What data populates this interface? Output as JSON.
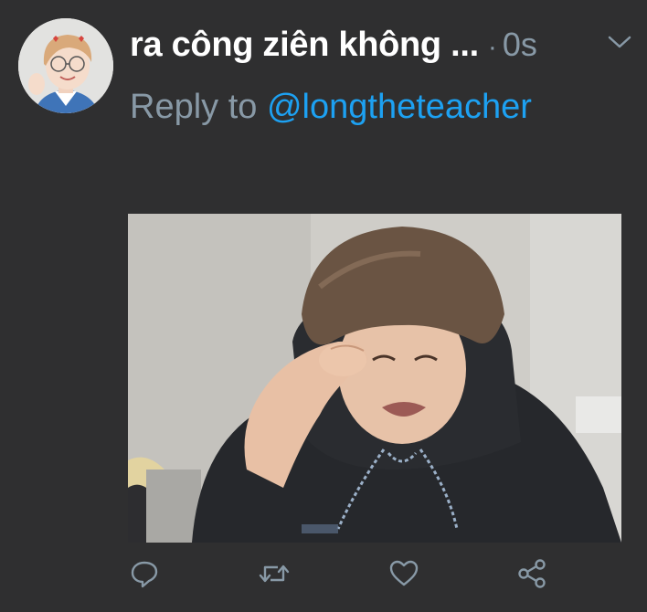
{
  "tweet": {
    "display_name": "ra công ziên không ...",
    "separator": "·",
    "timestamp": "0s",
    "reply_label": "Reply to",
    "reply_handle": "@longtheteacher"
  },
  "icons": {
    "caret": "chevron-down-icon",
    "reply": "reply-icon",
    "retweet": "retweet-icon",
    "like": "heart-icon",
    "share": "share-icon"
  },
  "colors": {
    "background": "#2f2f30",
    "name": "#ffffff",
    "muted": "#8899a6",
    "link": "#1da1f2"
  }
}
